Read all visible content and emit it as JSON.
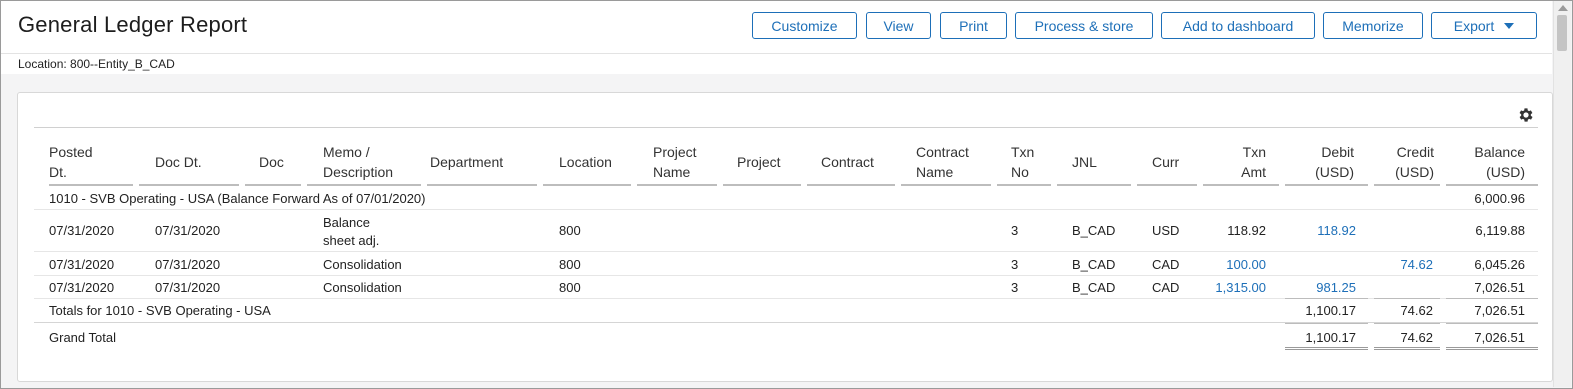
{
  "title": "General Ledger Report",
  "toolbar": {
    "customize": "Customize",
    "view": "View",
    "print": "Print",
    "process_store": "Process & store",
    "add_dashboard": "Add to dashboard",
    "memorize": "Memorize",
    "export": "Export"
  },
  "location_label": "Location: 800--Entity_B_CAD",
  "settings_icon": "gear-icon",
  "columns": {
    "posted_dt": [
      "Posted",
      "Dt."
    ],
    "doc_dt": "Doc Dt.",
    "doc": "Doc",
    "memo": [
      "Memo /",
      "Description"
    ],
    "department": "Department",
    "location": "Location",
    "project_name": [
      "Project",
      "Name"
    ],
    "project": "Project",
    "contract": "Contract",
    "contract_name": [
      "Contract",
      "Name"
    ],
    "txn_no": [
      "Txn",
      "No"
    ],
    "jnl": "JNL",
    "curr": "Curr",
    "txn_amt": [
      "Txn",
      "Amt"
    ],
    "debit": [
      "Debit",
      "(USD)"
    ],
    "credit": [
      "Credit",
      "(USD)"
    ],
    "balance": [
      "Balance",
      "(USD)"
    ]
  },
  "group": {
    "title": "1010 - SVB Operating - USA (Balance Forward As of 07/01/2020)",
    "balance": "6,000.96"
  },
  "rows": [
    {
      "posted": "07/31/2020",
      "doc_dt": "07/31/2020",
      "memo": [
        "Balance",
        "sheet adj."
      ],
      "location": "800",
      "txn_no": "3",
      "jnl": "B_CAD",
      "curr": "USD",
      "txn_amt": "118.92",
      "debit": "118.92",
      "credit": "",
      "balance": "6,119.88"
    },
    {
      "posted": "07/31/2020",
      "doc_dt": "07/31/2020",
      "memo": [
        "Consolidation"
      ],
      "location": "800",
      "txn_no": "3",
      "jnl": "B_CAD",
      "curr": "CAD",
      "txn_amt": "100.00",
      "debit": "",
      "credit": "74.62",
      "balance": "6,045.26"
    },
    {
      "posted": "07/31/2020",
      "doc_dt": "07/31/2020",
      "memo": [
        "Consolidation"
      ],
      "location": "800",
      "txn_no": "3",
      "jnl": "B_CAD",
      "curr": "CAD",
      "txn_amt": "1,315.00",
      "debit": "981.25",
      "credit": "",
      "balance": "7,026.51"
    }
  ],
  "totals": {
    "label": "Totals for 1010 - SVB Operating - USA",
    "debit": "1,100.17",
    "credit": "74.62",
    "balance": "7,026.51"
  },
  "grand_total": {
    "label": "Grand Total",
    "debit": "1,100.17",
    "credit": "74.62",
    "balance": "7,026.51"
  },
  "colors": {
    "accent": "#1d6fb8",
    "link": "#1d6fb8"
  }
}
